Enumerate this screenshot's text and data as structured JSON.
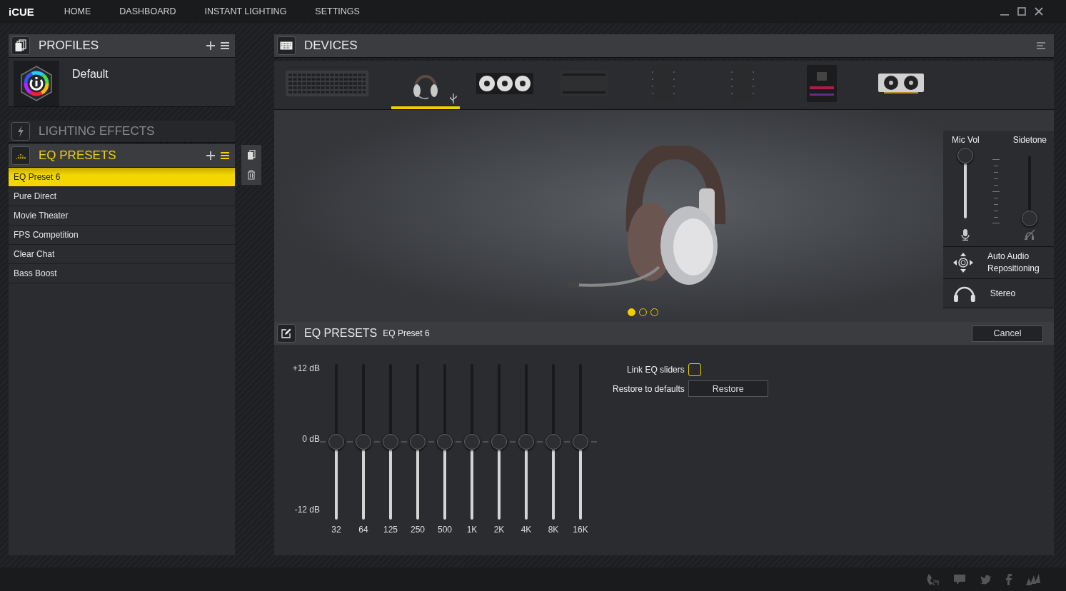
{
  "app": {
    "logo": "iCUE"
  },
  "nav": [
    {
      "label": "HOME"
    },
    {
      "label": "DASHBOARD"
    },
    {
      "label": "INSTANT LIGHTING"
    },
    {
      "label": "SETTINGS"
    }
  ],
  "profiles": {
    "title": "PROFILES",
    "items": [
      {
        "name": "Default"
      }
    ]
  },
  "lighting_effects": {
    "title": "LIGHTING EFFECTS"
  },
  "eq_presets": {
    "title": "EQ PRESETS",
    "items": [
      {
        "name": "EQ Preset 6",
        "selected": true
      },
      {
        "name": "Pure Direct",
        "selected": false
      },
      {
        "name": "Movie Theater",
        "selected": false
      },
      {
        "name": "FPS Competition",
        "selected": false
      },
      {
        "name": "Clear Chat",
        "selected": false
      },
      {
        "name": "Bass Boost",
        "selected": false
      }
    ]
  },
  "devices": {
    "title": "DEVICES",
    "items": [
      {
        "kind": "keyboard",
        "selected": false,
        "usb": false
      },
      {
        "kind": "headset",
        "selected": true,
        "usb": true
      },
      {
        "kind": "cooler",
        "selected": false,
        "usb": false
      },
      {
        "kind": "controller",
        "selected": false,
        "usb": false
      },
      {
        "kind": "hub",
        "selected": false,
        "usb": false
      },
      {
        "kind": "hub",
        "selected": false,
        "usb": false
      },
      {
        "kind": "motherboard",
        "selected": false,
        "usb": false
      },
      {
        "kind": "gpu",
        "selected": false,
        "usb": false
      }
    ]
  },
  "carousel": [
    {
      "selected": true
    },
    {
      "selected": false
    },
    {
      "selected": false
    }
  ],
  "audio_controls": {
    "mic_vol": {
      "label": "Mic Vol",
      "level": 1
    },
    "sidetone": {
      "label": "Sidetone",
      "level": 0
    },
    "options": [
      {
        "label": "Auto Audio Repositioning",
        "kind": "position"
      },
      {
        "label": "Stereo",
        "kind": "stereo"
      }
    ]
  },
  "eq_editor": {
    "title": "EQ PRESETS",
    "preset": "EQ Preset 6",
    "cancel": "Cancel",
    "scale": [
      "+12 dB",
      "0 dB",
      "-12 dB"
    ],
    "bands": [
      {
        "label": "32",
        "level": 0.5
      },
      {
        "label": "64",
        "level": 0.5
      },
      {
        "label": "125",
        "level": 0.5
      },
      {
        "label": "250",
        "level": 0.5
      },
      {
        "label": "500",
        "level": 0.5
      },
      {
        "label": "1K",
        "level": 0.5
      },
      {
        "label": "2K",
        "level": 0.5
      },
      {
        "label": "4K",
        "level": 0.5
      },
      {
        "label": "8K",
        "level": 0.5
      },
      {
        "label": "16K",
        "level": 0.5
      }
    ],
    "link_sliders": {
      "label": "Link EQ sliders",
      "checked": false
    },
    "restore": {
      "label": "Restore to defaults",
      "button": "Restore"
    }
  }
}
